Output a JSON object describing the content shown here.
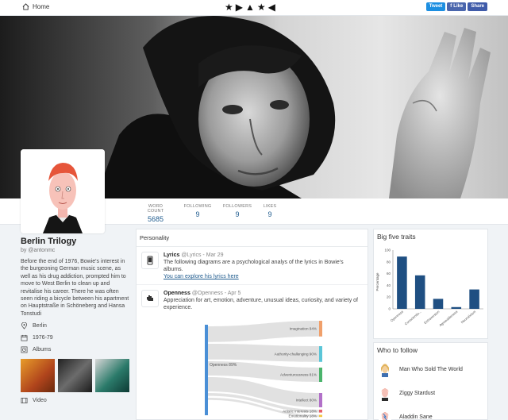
{
  "topbar": {
    "home_label": "Home",
    "share": {
      "tweet": "Tweet",
      "like": "Like",
      "share": "Share"
    }
  },
  "stats": [
    {
      "label": "WORD COUNT",
      "value": "5685"
    },
    {
      "label": "FOLLOWING",
      "value": "9"
    },
    {
      "label": "FOLLOWERS",
      "value": "9"
    },
    {
      "label": "LIKES",
      "value": "9"
    }
  ],
  "profile": {
    "title": "Berlin Trilogy",
    "handle": "by @antonmc",
    "bio": "Before the end of 1976, Bowie's interest in the burgeoning German music scene, as well as his drug addiction, prompted him to move to West Berlin to clean up and revitalise his career. There he was often seen riding a bicycle between his apartment on Hauptstraße in Schöneberg and Hansa Tonstudi",
    "location": "Berlin",
    "dates": "1976-79",
    "albums_label": "Albums",
    "video_label": "Video"
  },
  "personality": {
    "header": "Personality",
    "posts": [
      {
        "name": "Lyrics",
        "handle": "@Lyrics",
        "date": "Mar 29",
        "text": "The following diagrams are a psychological analys of the lyrics in Bowie's albums.",
        "link": "You can explore his lyrics here"
      },
      {
        "name": "Openness",
        "handle": "@Openness",
        "date": "Apr 5",
        "text": "Appreciation for art, emotion, adventure, unusual ideas, curiosity, and variety of experience."
      }
    ],
    "sankey": {
      "source": "Openness 89%",
      "targets": [
        {
          "label": "Imagination 94%",
          "color": "#f0a06b"
        },
        {
          "label": "Authority-challenging 90%",
          "color": "#5bc6d8"
        },
        {
          "label": "Adventurousness 81%",
          "color": "#4bb46c"
        },
        {
          "label": "Intellect 80%",
          "color": "#b271c9"
        },
        {
          "label": "Artistic interests 18%",
          "color": "#e85f6a"
        },
        {
          "label": "Emotionality 18%",
          "color": "#f3c53f"
        }
      ]
    }
  },
  "big_five": {
    "title": "Big five traits",
    "chart_data": {
      "type": "bar",
      "ylabel": "Percentage",
      "categories": [
        "Openness",
        "Conscientio...",
        "Extraversion",
        "Agreeableness",
        "Neuroticism"
      ],
      "values": [
        89,
        57,
        17,
        3,
        33
      ],
      "ylim": [
        0,
        100
      ],
      "ticks": [
        0,
        20,
        40,
        60,
        80,
        100
      ],
      "color": "#1f4f82"
    }
  },
  "who_to_follow": {
    "title": "Who to follow",
    "items": [
      {
        "name": "Man Who Sold The World"
      },
      {
        "name": "Ziggy Stardust"
      },
      {
        "name": "Aladdin Sane"
      }
    ]
  }
}
